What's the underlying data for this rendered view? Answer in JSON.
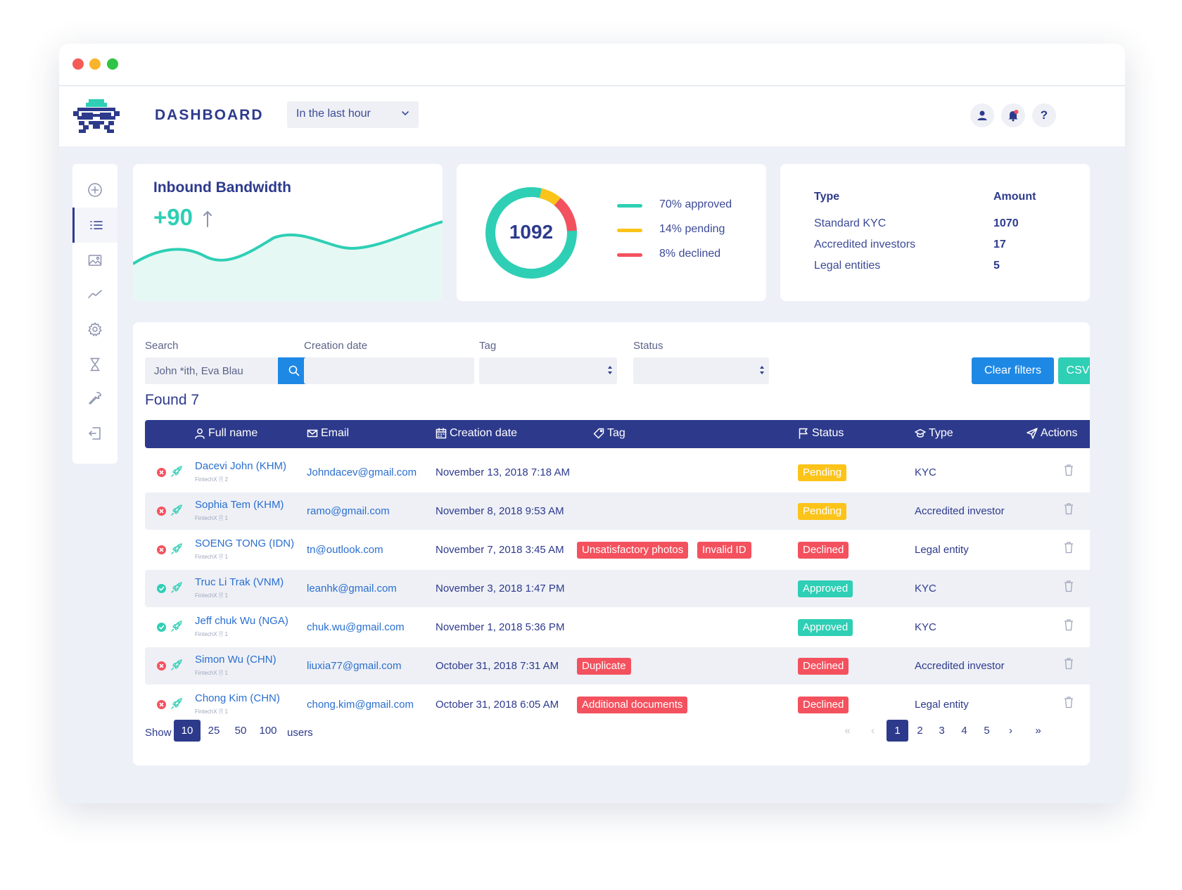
{
  "header": {
    "title": "DASHBOARD",
    "time_filter": "In the last hour"
  },
  "bandwidth": {
    "title": "Inbound Bandwidth",
    "value": "+90"
  },
  "kyc_summary": {
    "total": "1092",
    "legend": [
      {
        "label": "70% approved",
        "color": "#2ecfb5"
      },
      {
        "label": "14% pending",
        "color": "#fcc419"
      },
      {
        "label": "8% declined",
        "color": "#f4515e"
      }
    ]
  },
  "type_table": {
    "header_type": "Type",
    "header_amount": "Amount",
    "rows": [
      {
        "type": "Standard KYC",
        "amount": "1070"
      },
      {
        "type": "Accredited investors",
        "amount": "17"
      },
      {
        "type": "Legal entities",
        "amount": "5"
      }
    ]
  },
  "filters": {
    "search_label": "Search",
    "search_placeholder": "John *ith, Eva Blau",
    "creation_label": "Creation date",
    "tag_label": "Tag",
    "status_label": "Status",
    "clear_label": "Clear filters",
    "csv_label": "CSV"
  },
  "found": "Found 7",
  "columns": {
    "name": "Full name",
    "email": "Email",
    "date": "Creation date",
    "tag": "Tag",
    "status": "Status",
    "type": "Type",
    "actions": "Actions"
  },
  "rows": [
    {
      "name": "Dacevi John (KHM)",
      "sub": "FintechX 🗎 2",
      "email": "Johndacev@gmail.com",
      "date": "November 13, 2018 7:18 AM",
      "tags": [],
      "status": "Pending",
      "type": "KYC"
    },
    {
      "name": "Sophia Tem (KHM)",
      "sub": "FintechX 🗎 1",
      "email": "ramo@gmail.com",
      "date": "November 8, 2018 9:53 AM",
      "tags": [],
      "status": "Pending",
      "type": "Accredited investor"
    },
    {
      "name": "SOENG TONG (IDN)",
      "sub": "FintechX 🗎 1",
      "email": "tn@outlook.com",
      "date": "November 7, 2018 3:45 AM",
      "tags": [
        "Unsatisfactory photos",
        "Invalid ID"
      ],
      "status": "Declined",
      "type": "Legal entity"
    },
    {
      "name": "Truc Li Trak (VNM)",
      "sub": "FintechX 🗎 1",
      "email": "leanhk@gmail.com",
      "date": "November 3, 2018 1:47 PM",
      "tags": [],
      "status": "Approved",
      "type": "KYC"
    },
    {
      "name": "Jeff chuk Wu (NGA)",
      "sub": "FintechX 🗎 1",
      "email": "chuk.wu@gmail.com",
      "date": "November 1, 2018 5:36 PM",
      "tags": [],
      "status": "Approved",
      "type": "KYC"
    },
    {
      "name": "Simon Wu (CHN)",
      "sub": "FintechX 🗎 1",
      "email": "liuxia77@gmail.com",
      "date": "October 31, 2018 7:31 AM",
      "tags": [
        "Duplicate"
      ],
      "status": "Declined",
      "type": "Accredited investor"
    },
    {
      "name": "Chong Kim (CHN)",
      "sub": "FintechX 🗎 1",
      "email": "chong.kim@gmail.com",
      "date": "October 31, 2018 6:05 AM",
      "tags": [
        "Additional documents"
      ],
      "status": "Declined",
      "type": "Legal entity"
    }
  ],
  "status_colors": {
    "Pending": "#fcc419",
    "Approved": "#2ecfb5",
    "Declined": "#f4515e"
  },
  "pagination": {
    "show_label": "Show",
    "sizes": [
      "10",
      "25",
      "50",
      "100"
    ],
    "active_size": "10",
    "users_label": "users",
    "first": "«",
    "prev": "‹",
    "pages": [
      "1",
      "2",
      "3",
      "4",
      "5"
    ],
    "active_page": "1",
    "next": "›",
    "last": "»"
  },
  "icons": {
    "sidebar": [
      "add-icon",
      "list-icon",
      "image-icon",
      "chart-icon",
      "gear-icon",
      "hourglass-icon",
      "wrench-icon",
      "logout-icon"
    ],
    "header": [
      "user-icon",
      "bell-icon",
      "help-icon"
    ]
  }
}
